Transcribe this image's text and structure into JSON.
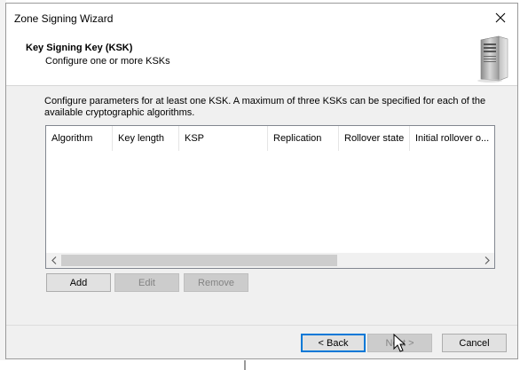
{
  "window": {
    "title": "Zone Signing Wizard"
  },
  "header": {
    "title": "Key Signing Key (KSK)",
    "subtitle": "Configure one or more KSKs",
    "icon": "server-icon"
  },
  "description": "Configure parameters for at least one KSK. A maximum of three KSKs can be specified for each of the available cryptographic algorithms.",
  "list": {
    "columns": [
      "Algorithm",
      "Key length",
      "KSP",
      "Replication",
      "Rollover state",
      "Initial rollover o..."
    ],
    "rows": []
  },
  "actions": {
    "add": "Add",
    "edit": "Edit",
    "remove": "Remove"
  },
  "footer": {
    "back": "< Back",
    "next": "Next >",
    "cancel": "Cancel"
  },
  "colors": {
    "focus": "#0078d7",
    "dialog_bg": "#f0f0f0"
  }
}
